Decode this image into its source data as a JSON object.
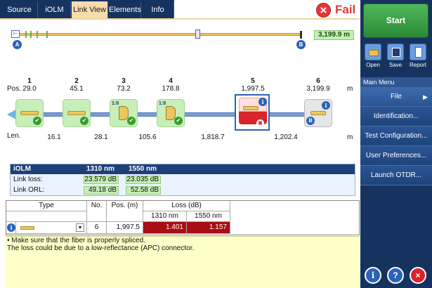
{
  "tabs": [
    {
      "label": "Source"
    },
    {
      "label": "iOLM"
    },
    {
      "label": "Link View"
    },
    {
      "label": "Elements"
    },
    {
      "label": "Info"
    }
  ],
  "status": {
    "label": "Fail",
    "color": "#e2383a",
    "icon": "fail-x-icon"
  },
  "overview": {
    "total_length": "3,199.9 m",
    "marker_a": "A",
    "marker_b": "B"
  },
  "linkview": {
    "pos_label": "Pos.",
    "len_label": "Len.",
    "unit": "m",
    "events": [
      {
        "num": "1",
        "pos": "29.0"
      },
      {
        "num": "2",
        "pos": "45.1"
      },
      {
        "num": "3",
        "pos": "73.2",
        "splitter": "1:8"
      },
      {
        "num": "4",
        "pos": "178.8",
        "splitter": "1:8"
      },
      {
        "num": "5",
        "pos": "1,997.5",
        "status": "fail"
      },
      {
        "num": "6",
        "pos": "3,199.9",
        "type": "end"
      }
    ],
    "lengths": [
      "16.1",
      "28.1",
      "105.6",
      "1,818.7",
      "1,202.4"
    ]
  },
  "summary": {
    "header": {
      "name": "iOLM",
      "w1": "1310 nm",
      "w2": "1550 nm"
    },
    "rows": [
      {
        "label": "Link loss:",
        "v1": "23.579 dB",
        "v2": "23.035 dB"
      },
      {
        "label": "Link ORL:",
        "v1": "49.18 dB",
        "v2": "52.58 dB"
      }
    ]
  },
  "table": {
    "headers": {
      "type": "Type",
      "no": "No.",
      "pos": "Pos. (m)",
      "loss": "Loss (dB)",
      "w1": "1310 nm",
      "w2": "1550 nm"
    },
    "row": {
      "no": "6",
      "pos": "1,997.5",
      "loss1": "1.401",
      "loss2": "1.157"
    }
  },
  "recommendations": [
    "• Make sure that the fiber is properly spliced.",
    "The loss could be due to a low-reflectance (APC) connector."
  ],
  "side": {
    "start": "Start",
    "tools": [
      {
        "label": "Open",
        "icon": "folder-open-icon"
      },
      {
        "label": "Save",
        "icon": "save-icon"
      },
      {
        "label": "Report",
        "icon": "report-icon"
      }
    ],
    "main_menu_title": "Main Menu",
    "menu": [
      "File",
      "Identification...",
      "Test Configuration...",
      "User Preferences...",
      "Launch OTDR..."
    ],
    "bottom": [
      {
        "icon": "info-icon"
      },
      {
        "icon": "help-icon"
      },
      {
        "icon": "close-icon"
      }
    ]
  }
}
